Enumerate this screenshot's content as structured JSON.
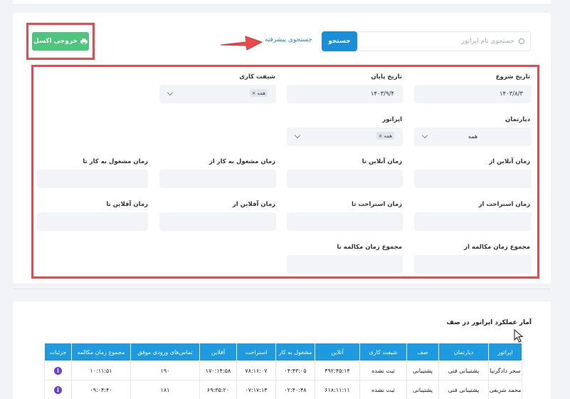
{
  "toolbar": {
    "search_placeholder": "جستجوی نام اپراتور",
    "search_button": "جستجو",
    "advanced_search": "جستجوی پیشرفته",
    "excel_button": "خروجی اکسل"
  },
  "filters": {
    "start_date_label": "تاریخ شروع",
    "start_date_value": "۱۴۰۳/۸/۳",
    "end_date_label": "تاریخ پایان",
    "end_date_value": "۱۴۰۳/۹/۴",
    "shift_label": "شیفت کاری",
    "shift_tag": "همه",
    "department_label": "دپارتمان",
    "department_value": "همه",
    "operator_label": "اپراتور",
    "operator_tag": "همه",
    "online_from_label": "زمان آنلاین از",
    "online_to_label": "زمان آنلاین تا",
    "busy_from_label": "زمان مشغول به کار از",
    "busy_to_label": "زمان مشغول به کار تا",
    "rest_from_label": "زمان استراحت از",
    "rest_to_label": "زمان استراحت تا",
    "offline_from_label": "زمان آفلاین از",
    "offline_to_label": "زمان آفلاین تا",
    "talk_from_label": "مجموع زمان مکالمه از",
    "talk_to_label": "مجموع زمان مکالمه تا"
  },
  "stats": {
    "title": "آمار عملکرد اپراتور در صف",
    "columns": [
      "اپراتور",
      "دپارتمان",
      "صف",
      "شیفت کاری",
      "آنلاین",
      "مشغول به کار",
      "استراحت",
      "آفلاین",
      "تماس‌های ورودی موفق",
      "مجموع زمان مکالمه",
      "جزئیات"
    ],
    "rows": [
      [
        "سحر دادگرنیا",
        "پشتیبانی فنی",
        "پشتیبانی",
        "ثبت نشده",
        "۴۹۲:۴۵:۱۴",
        "۰۴:۴۳:۰۵",
        "۷۸:۱۶:۰۷",
        "۱۷۰:۱۴:۵۸",
        "۱۹۰",
        "۱۰:۱۱:۵۱"
      ],
      [
        "محمد شریفی",
        "پشتیبانی فنی",
        "پشتیبانی",
        "ثبت نشده",
        "۶۱۸:۱۱:۱۱",
        "۰۲:۴۰:۴۸",
        "۰۷:۱۷:۱۴",
        "۶۹:۳۵:۲۰",
        "۱۸۱",
        "۰۹:۰۴:۴۰"
      ]
    ],
    "details_icon": "info-icon"
  },
  "colors": {
    "accent": "#1a8fd7",
    "excel": "#4fc47c",
    "highlight": "#ea4a4b",
    "header": "#1e9ae0"
  }
}
